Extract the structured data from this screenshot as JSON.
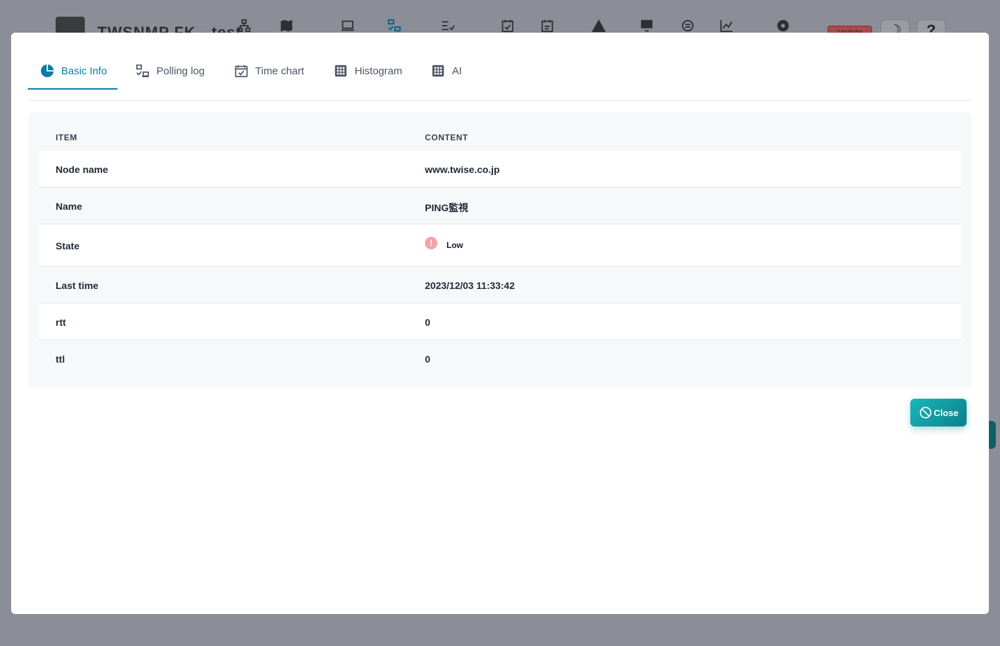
{
  "app": {
    "title": "TWSNMP FK - test",
    "update_label": "Update",
    "colors": {
      "accent": "#0a7ea4",
      "close_button": "#14a3ab",
      "error": "#f4a3a3"
    }
  },
  "tabs": [
    {
      "label": "Basic Info",
      "icon": "pie-chart-icon",
      "active": true
    },
    {
      "label": "Polling log",
      "icon": "polling-icon",
      "active": false
    },
    {
      "label": "Time chart",
      "icon": "calendar-check-icon",
      "active": false
    },
    {
      "label": "Histogram",
      "icon": "grid-icon",
      "active": false
    },
    {
      "label": "AI",
      "icon": "grid-icon",
      "active": false
    }
  ],
  "table": {
    "headers": [
      "ITEM",
      "CONTENT"
    ],
    "rows": [
      {
        "item": "Node name",
        "content": "www.twise.co.jp"
      },
      {
        "item": "Name",
        "content": "PING監視"
      },
      {
        "item": "State",
        "content": "Low",
        "icon": "exclamation-circle-icon"
      },
      {
        "item": "Last time",
        "content": "2023/12/03 11:33:42"
      },
      {
        "item": "rtt",
        "content": "0"
      },
      {
        "item": "ttl",
        "content": "0"
      }
    ]
  },
  "close_button": {
    "label": "Close",
    "icon": "ban-icon"
  }
}
